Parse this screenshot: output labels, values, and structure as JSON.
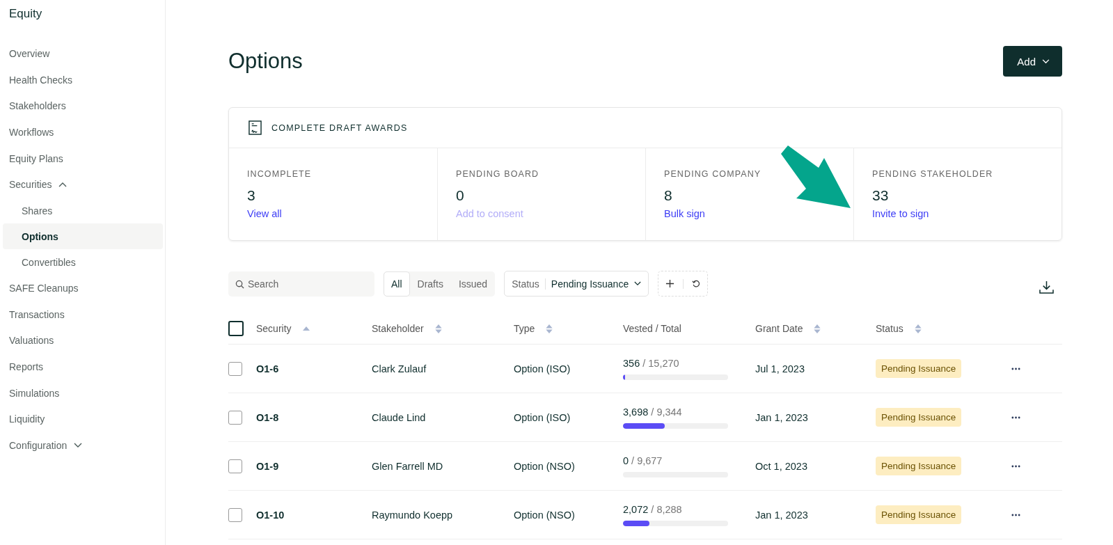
{
  "sidebar": {
    "title": "Equity",
    "items": [
      {
        "label": "Overview",
        "selected": false
      },
      {
        "label": "Health Checks",
        "selected": false
      },
      {
        "label": "Stakeholders",
        "selected": false
      },
      {
        "label": "Workflows",
        "selected": false
      },
      {
        "label": "Equity Plans",
        "selected": false
      },
      {
        "label": "Securities",
        "selected": false,
        "expanded": true,
        "children": [
          {
            "label": "Shares",
            "selected": false
          },
          {
            "label": "Options",
            "selected": true
          },
          {
            "label": "Convertibles",
            "selected": false
          }
        ]
      },
      {
        "label": "SAFE Cleanups",
        "selected": false
      },
      {
        "label": "Transactions",
        "selected": false
      },
      {
        "label": "Valuations",
        "selected": false
      },
      {
        "label": "Reports",
        "selected": false
      },
      {
        "label": "Simulations",
        "selected": false
      },
      {
        "label": "Liquidity",
        "selected": false
      },
      {
        "label": "Configuration",
        "selected": false,
        "expanded": false
      }
    ]
  },
  "page": {
    "title": "Options",
    "add_button": "Add"
  },
  "drafts_card": {
    "title": "COMPLETE DRAFT AWARDS",
    "stats": [
      {
        "label": "INCOMPLETE",
        "value": "3",
        "action": "View all",
        "disabled": false
      },
      {
        "label": "PENDING BOARD",
        "value": "0",
        "action": "Add to consent",
        "disabled": true
      },
      {
        "label": "PENDING COMPANY",
        "value": "8",
        "action": "Bulk sign",
        "disabled": false
      },
      {
        "label": "PENDING STAKEHOLDER",
        "value": "33",
        "action": "Invite to sign",
        "disabled": false
      }
    ]
  },
  "toolbar": {
    "search": {
      "placeholder": "Search"
    },
    "tabs": [
      {
        "label": "All",
        "selected": true
      },
      {
        "label": "Drafts",
        "selected": false
      },
      {
        "label": "Issued",
        "selected": false
      }
    ],
    "status_filter": {
      "label": "Status",
      "value": "Pending Issuance"
    }
  },
  "table": {
    "select_all_checked": false,
    "columns": [
      {
        "label": "Security",
        "kind": "ascending"
      },
      {
        "label": "Stakeholder",
        "kind": "sortable"
      },
      {
        "label": "Type",
        "kind": "sortable"
      },
      {
        "label": "Vested / Total",
        "kind": "plain"
      },
      {
        "label": "Grant Date",
        "kind": "sortable"
      },
      {
        "label": "Status",
        "kind": "sortable"
      }
    ],
    "rows": [
      {
        "checked": false,
        "security": "O1-6",
        "stakeholder": "Clark Zulauf",
        "type": "Option (ISO)",
        "vested": "356",
        "total": "/ 15,270",
        "level": 0.023,
        "grant_date": "Jul 1, 2023",
        "status": "Pending Issuance"
      },
      {
        "checked": false,
        "security": "O1-8",
        "stakeholder": "Claude Lind",
        "type": "Option (ISO)",
        "vested": "3,698",
        "total": "/ 9,344",
        "level": 0.396,
        "grant_date": "Jan 1, 2023",
        "status": "Pending Issuance"
      },
      {
        "checked": false,
        "security": "O1-9",
        "stakeholder": "Glen Farrell MD",
        "type": "Option (NSO)",
        "vested": "0",
        "total": "/ 9,677",
        "level": 0,
        "grant_date": "Oct 1, 2023",
        "status": "Pending Issuance"
      },
      {
        "checked": false,
        "security": "O1-10",
        "stakeholder": "Raymundo Koepp",
        "type": "Option (NSO)",
        "vested": "2,072",
        "total": "/ 8,288",
        "level": 0.25,
        "grant_date": "Jan 1, 2023",
        "status": "Pending Issuance"
      }
    ]
  }
}
